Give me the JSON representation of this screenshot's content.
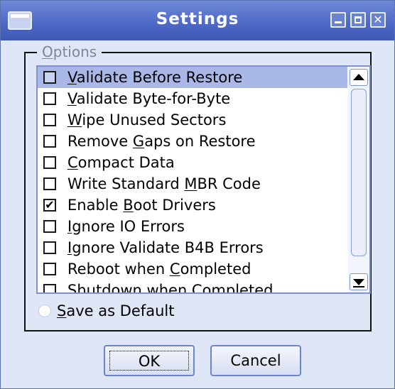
{
  "window": {
    "title": "Settings"
  },
  "options_group": {
    "title": "Options",
    "items": [
      {
        "label": "Validate Before Restore",
        "checked": false,
        "selected": true
      },
      {
        "label": "Validate Byte-for-Byte",
        "checked": false,
        "selected": false
      },
      {
        "label": "Wipe Unused Sectors",
        "checked": false,
        "selected": false
      },
      {
        "label": "Remove Gaps on Restore",
        "checked": false,
        "selected": false
      },
      {
        "label": "Compact Data",
        "checked": false,
        "selected": false
      },
      {
        "label": "Write Standard MBR Code",
        "checked": false,
        "selected": false
      },
      {
        "label": "Enable Boot Drivers",
        "checked": true,
        "selected": false
      },
      {
        "label": "Ignore IO Errors",
        "checked": false,
        "selected": false
      },
      {
        "label": "Ignore Validate B4B Errors",
        "checked": false,
        "selected": false
      },
      {
        "label": "Reboot when Completed",
        "checked": false,
        "selected": false
      },
      {
        "label": "Shutdown when Completed",
        "checked": false,
        "selected": false
      }
    ]
  },
  "save_default": {
    "label": "Save as Default",
    "selected": false
  },
  "buttons": {
    "ok": "OK",
    "cancel": "Cancel"
  },
  "colors": {
    "titlebar": "#4d68c4",
    "window_bg": "#dfe6f6",
    "selection": "#a9b8e6"
  }
}
